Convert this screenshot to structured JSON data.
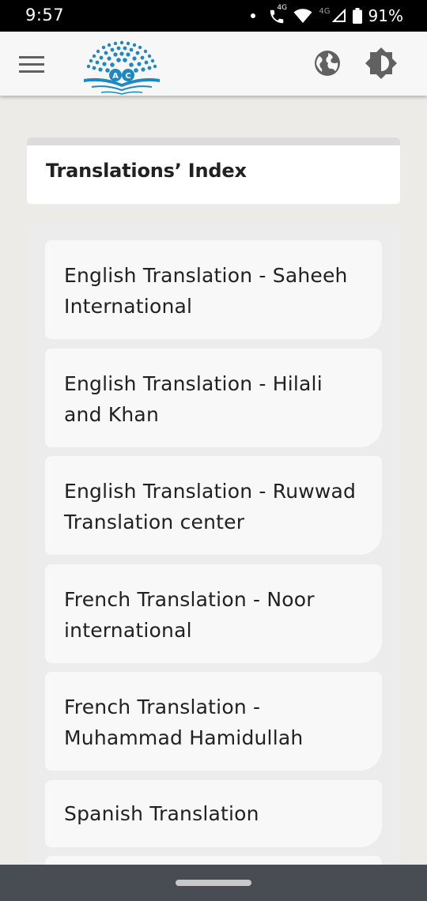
{
  "status_bar": {
    "time": "9:57",
    "network_primary": "4G",
    "network_secondary": "4G",
    "battery": "91%"
  },
  "app_bar": {
    "icons": {
      "menu": "hamburger-menu-icon",
      "logo": "app-logo",
      "language": "globe-icon",
      "theme": "brightness-icon"
    }
  },
  "header": {
    "title": "Translations’ Index"
  },
  "translations": [
    {
      "label": "English Translation - Saheeh International"
    },
    {
      "label": "English Translation - Hilali and Khan"
    },
    {
      "label": "English Translation - Ruwwad Translation center"
    },
    {
      "label": "French Translation - Noor international"
    },
    {
      "label": "French Translation - Muhammad Hamidullah"
    },
    {
      "label": "Spanish Translation"
    },
    {
      "label": ""
    }
  ],
  "colors": {
    "background": "#ecebe7",
    "app_bar": "#f7f7f7",
    "logo_blue": "#1d88c2",
    "icon_gray": "#616161",
    "nav_bar": "#474d52"
  }
}
